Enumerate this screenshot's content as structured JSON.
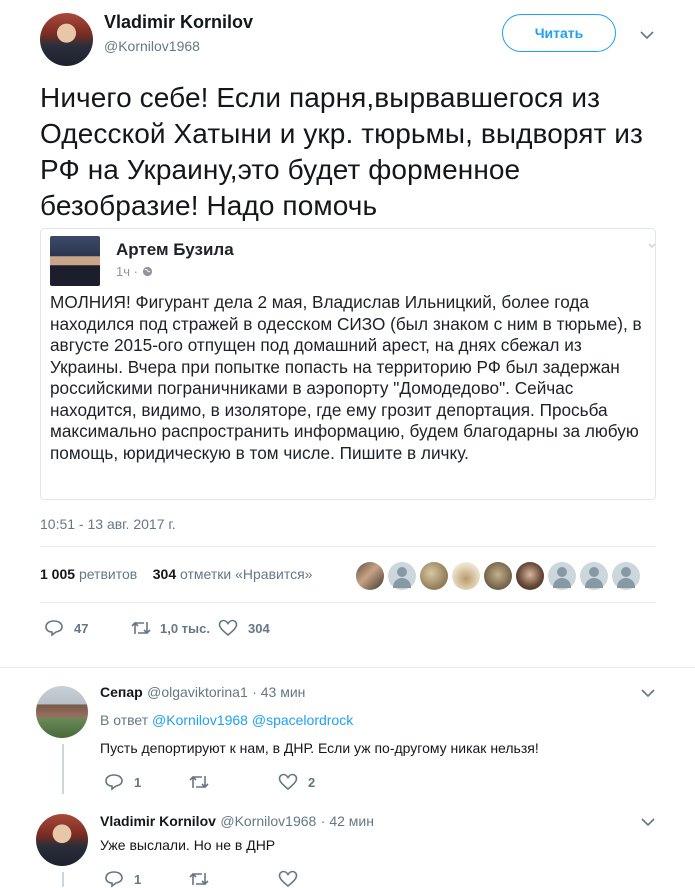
{
  "author": {
    "name": "Vladimir Kornilov",
    "handle": "@Kornilov1968"
  },
  "follow_label": "Читать",
  "tweet_text": "Ничего себе! Если парня,вырвавшегося из Одесской Хатыни и укр. тюрьмы, выдворят из РФ на Украину,это будет форменное безобразие! Надо помочь",
  "quote": {
    "name": "Артем Бузила",
    "time": "1ч",
    "text": "МОЛНИЯ! Фигурант дела 2 мая, Владислав Ильницкий, более года находился под стражей в одесском СИЗО (был знаком с ним в тюрьме), в августе 2015-ого отпущен под домашний арест, на днях сбежал из Украины. Вчера при попытке попасть на территорию РФ был задержан российскими пограничниками в аэропорту \"Домодедово\". Сейчас находится, видимо, в изоляторе, где ему грозит депортация. Просьба максимально распространить информацию, будем благодарны за любую помощь, юридическую в том числе. Пишите в личку."
  },
  "timestamp": "10:51 - 13 авг. 2017 г.",
  "stats": {
    "retweets_count": "1 005",
    "retweets_label": "ретвитов",
    "likes_count": "304",
    "likes_label": "отметки «Нравится»"
  },
  "actions": {
    "replies": "47",
    "retweets": "1,0 тыс.",
    "likes": "304"
  },
  "replies": [
    {
      "name": "Сепар",
      "handle": "@olgaviktorina1",
      "time": "· 43 мин",
      "in_reply_prefix": "В ответ",
      "mention1": "@Kornilov1968",
      "mention2": "@spacelordrock",
      "text": "Пусть депортируют к нам, в ДНР. Если уж по-другому никак нельзя!",
      "reply_count": "1",
      "retweet_count": "",
      "like_count": "2"
    },
    {
      "name": "Vladimir Kornilov",
      "handle": "@Kornilov1968",
      "time": "· 42 мин",
      "text": "Уже выслали. Но не в ДНР",
      "reply_count": "1",
      "retweet_count": "",
      "like_count": ""
    }
  ],
  "colors": {
    "accent": "#1da1f2",
    "muted": "#657786",
    "text": "#14171a",
    "divider": "#e6ecf0"
  }
}
